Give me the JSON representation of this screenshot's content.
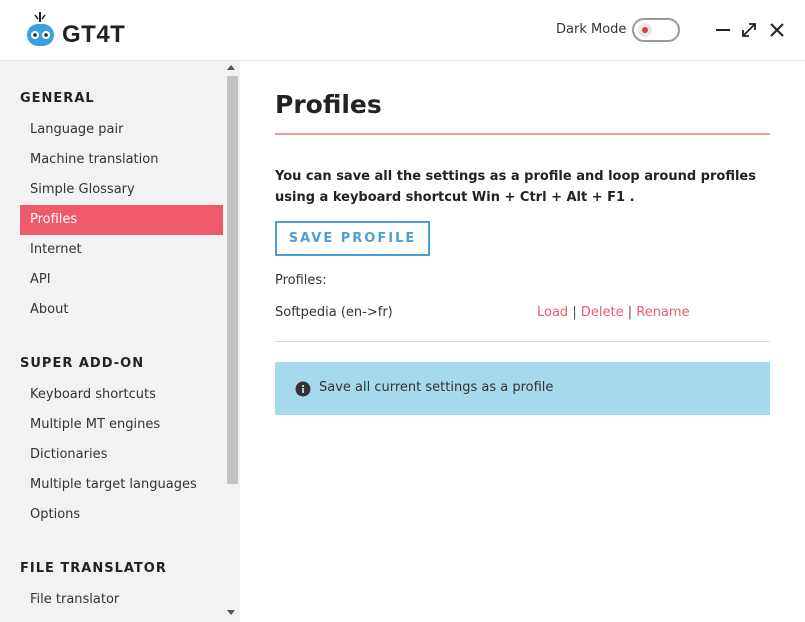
{
  "app": {
    "name": "GT4T"
  },
  "header": {
    "dark_mode_label": "Dark Mode",
    "dark_mode_on": false,
    "window_controls": [
      "minimize-icon",
      "maximize-icon",
      "close-icon"
    ]
  },
  "sidebar": {
    "sections": [
      {
        "title": "GENERAL",
        "items": [
          "Language pair",
          "Machine translation",
          "Simple Glossary",
          "Profiles",
          "Internet",
          "API",
          "About"
        ]
      },
      {
        "title": "SUPER ADD-ON",
        "items": [
          "Keyboard shortcuts",
          "Multiple MT engines",
          "Dictionaries",
          "Multiple target languages",
          "Options"
        ]
      },
      {
        "title": "FILE TRANSLATOR",
        "items": [
          "File translator"
        ]
      }
    ],
    "active_item": "Profiles"
  },
  "main": {
    "title": "Profiles",
    "description": "You can save all the settings as a profile and loop around profiles using a keyboard shortcut Win + Ctrl + Alt + F1 .",
    "save_button_label": "SAVE PROFILE",
    "profiles_label": "Profiles:",
    "profiles": [
      {
        "name": "Softpedia (en->fr)",
        "actions": [
          "Load",
          "Delete",
          "Rename"
        ],
        "separator": "|"
      }
    ],
    "info_text": "Save all current settings as a profile"
  },
  "colors": {
    "accent_red": "#f05b6b",
    "button_blue": "#4b9fd5",
    "info_bg": "#a6d8ee",
    "title_rule": "#f09a9a",
    "sidebar_bg": "#f2f2f2"
  }
}
